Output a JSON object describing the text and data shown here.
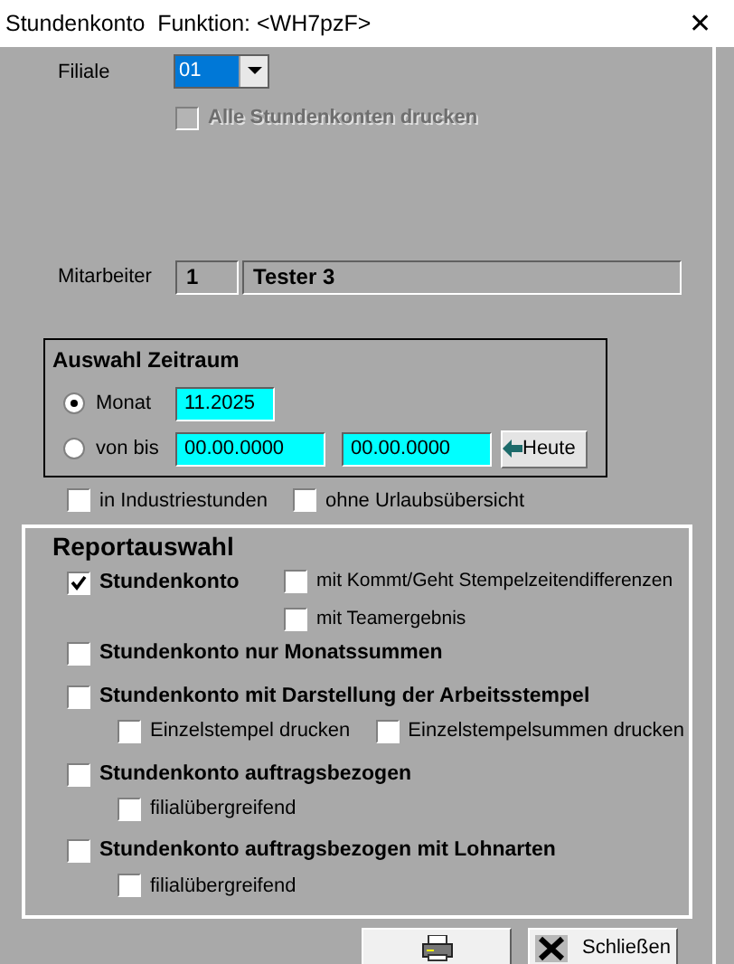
{
  "window": {
    "title": "Stundenkonto  Funktion: <WH7pzF>",
    "close": "✕"
  },
  "filiale": {
    "label": "Filiale",
    "value": "01"
  },
  "alle_drucken": {
    "label": "Alle Stundenkonten drucken",
    "checked": false,
    "disabled": true
  },
  "mitarbeiter": {
    "label": "Mitarbeiter",
    "number": "1",
    "name": "Tester 3"
  },
  "zeitraum": {
    "title": "Auswahl Zeitraum",
    "monat": {
      "label": "Monat",
      "selected": true,
      "value": "11.2025"
    },
    "von_bis": {
      "label": "von bis",
      "selected": false,
      "from": "00.00.0000",
      "to": "00.00.0000"
    },
    "heute_button": "Heute"
  },
  "options": [
    {
      "label": "in Industriestunden",
      "checked": false
    },
    {
      "label": "ohne Urlaubsübersicht",
      "checked": false
    }
  ],
  "reportauswahl": {
    "title": "Reportauswahl",
    "reports": [
      {
        "label": "Stundenkonto",
        "checked": true,
        "kind": "side",
        "suboptions": [
          {
            "label": "mit Kommt/Geht Stempelzeitendifferenzen",
            "checked": false
          },
          {
            "label": "mit Teamergebnis",
            "checked": false
          }
        ]
      },
      {
        "label": "Stundenkonto nur Monatssummen",
        "checked": false
      },
      {
        "label": "Stundenkonto mit Darstellung der Arbeitsstempel",
        "checked": false,
        "kind": "below",
        "suboptions": [
          {
            "label": "Einzelstempel drucken",
            "checked": false
          },
          {
            "label": "Einzelstempelsummen drucken",
            "checked": false
          }
        ]
      },
      {
        "label": "Stundenkonto auftragsbezogen",
        "checked": false,
        "kind": "below",
        "suboptions": [
          {
            "label": "filialübergreifend",
            "checked": false
          }
        ]
      },
      {
        "label": "Stundenkonto auftragsbezogen mit Lohnarten",
        "checked": false,
        "kind": "below",
        "suboptions": [
          {
            "label": "filialübergreifend",
            "checked": false
          }
        ]
      }
    ]
  },
  "buttons": [
    {
      "kind": "print"
    },
    {
      "kind": "close",
      "label": "Schließen"
    }
  ]
}
